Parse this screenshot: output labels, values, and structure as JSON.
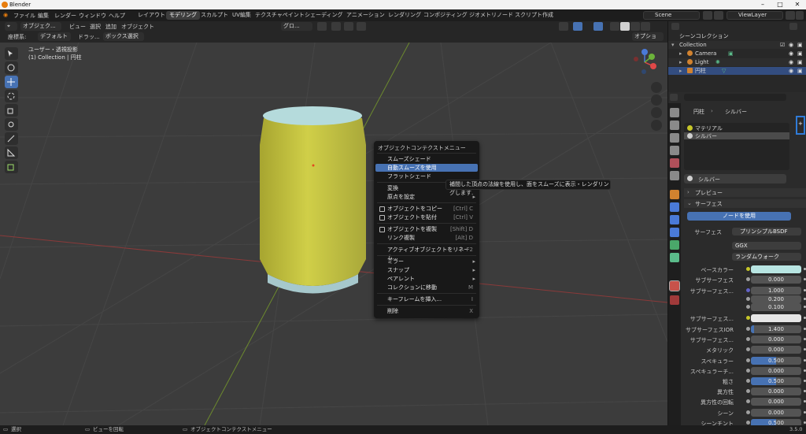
{
  "window": {
    "title": "Blender"
  },
  "menubar": {
    "menus": [
      "ファイル",
      "編集",
      "レンダー",
      "ウィンドウ",
      "ヘルプ"
    ],
    "workspaces": [
      "レイアウト",
      "モデリング",
      "スカルプト",
      "UV編集",
      "テクスチャペイント",
      "シェーディング",
      "アニメーション",
      "レンダリング",
      "コンポジティング",
      "ジオメトリノード",
      "スクリプト作成"
    ],
    "active_workspace": "モデリング",
    "scene": "Scene",
    "view_layer": "ViewLayer"
  },
  "viewport_header": {
    "mode": "オブジェク...",
    "menus": [
      "ビュー",
      "選択",
      "追加",
      "オブジェクト"
    ],
    "orientation_label": "座標系:",
    "orientation_value": "デフォルト",
    "drag_label": "ドラッ...",
    "drag_value": "ボックス選択",
    "transform": "グロ...",
    "options": "オプション"
  },
  "viewport": {
    "view_name": "ユーザー・透視投影",
    "collection_info": "(1) Collection | 円柱"
  },
  "context_menu": {
    "title": "オブジェクトコンテクストメニュー",
    "items": [
      {
        "label": "スムーズシェード",
        "shortcut": ""
      },
      {
        "label": "自動スムーズを使用",
        "shortcut": ""
      },
      {
        "label": "フラットシェード",
        "shortcut": ""
      },
      {
        "label": "変換",
        "shortcut": ""
      },
      {
        "label": "原点を設定",
        "shortcut": ""
      },
      {
        "label": "オブジェクトをコピー",
        "shortcut": "[Ctrl] C"
      },
      {
        "label": "オブジェクトを貼付",
        "shortcut": "[Ctrl] V"
      },
      {
        "label": "オブジェクトを複製",
        "shortcut": "[Shift] D"
      },
      {
        "label": "リンク複製",
        "shortcut": "[Alt] D"
      },
      {
        "label": "アクティブオブジェクトをリネーム...",
        "shortcut": "F2"
      },
      {
        "label": "ミラー",
        "shortcut": ""
      },
      {
        "label": "スナップ",
        "shortcut": ""
      },
      {
        "label": "ペアレント",
        "shortcut": ""
      },
      {
        "label": "コレクションに移動",
        "shortcut": "M"
      },
      {
        "label": "キーフレームを挿入...",
        "shortcut": "I"
      },
      {
        "label": "削除",
        "shortcut": "X"
      }
    ]
  },
  "tooltip": "補間した頂点の法線を使用し、面をスムーズに表示・レンダリングします.",
  "outliner": {
    "root": "シーンコレクション",
    "collection": "Collection",
    "items": [
      "Camera",
      "Light",
      "円柱"
    ]
  },
  "properties": {
    "breadcrumb_object": "円柱",
    "breadcrumb_material": "シルバー",
    "slots": [
      "マテリアル",
      "シルバー"
    ],
    "material_name": "シルバー",
    "preview_label": "プレビュー",
    "surface_label": "サーフェス",
    "use_nodes_label": "ノードを使用",
    "surface_shader_label": "サーフェス",
    "surface_shader_value": "プリンシプルBSDF",
    "distribution": "GGX",
    "subsurface_method": "ランダムウォーク",
    "fields": [
      {
        "label": "ベースカラー",
        "value": ""
      },
      {
        "label": "サブサーフェス",
        "value": "0.000"
      },
      {
        "label": "サブサーフェス...",
        "value": "1.000"
      },
      {
        "label": "",
        "value": "0.200"
      },
      {
        "label": "",
        "value": "0.100"
      },
      {
        "label": "サブサーフェス...",
        "value": ""
      },
      {
        "label": "サブサーフェスIOR",
        "value": "1.400"
      },
      {
        "label": "サブサーフェス...",
        "value": "0.000"
      },
      {
        "label": "メタリック",
        "value": "0.000"
      },
      {
        "label": "スペキュラー",
        "value": "0.500"
      },
      {
        "label": "スペキュラーチ...",
        "value": "0.000"
      },
      {
        "label": "粗さ",
        "value": "0.500"
      },
      {
        "label": "異方性",
        "value": "0.000"
      },
      {
        "label": "異方性の回転",
        "value": "0.000"
      },
      {
        "label": "シーン",
        "value": "0.000"
      },
      {
        "label": "シーンチント",
        "value": "0.500"
      }
    ],
    "base_color": "#b8e5e2",
    "subsurface_color": "#e6e6e6"
  },
  "statusbar": {
    "select": "選択",
    "rotate": "ビューを回転",
    "context": "オブジェクトコンテクストメニュー",
    "version": "3.5.0"
  }
}
